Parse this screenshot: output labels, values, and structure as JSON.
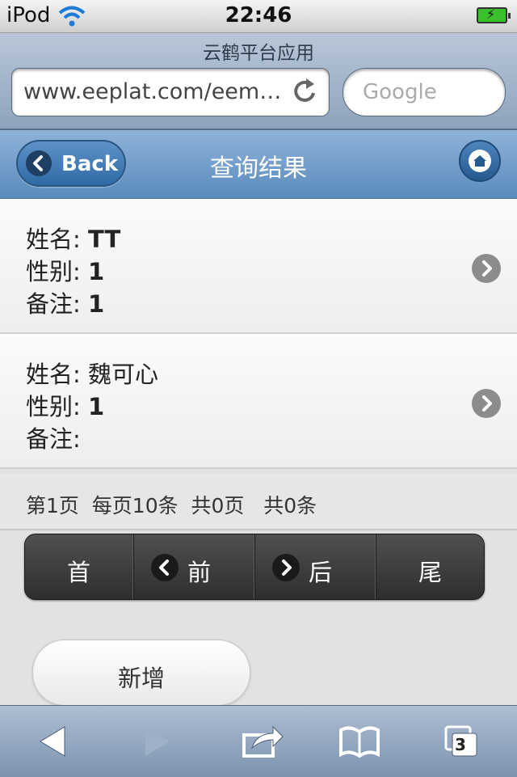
{
  "status_bar": {
    "carrier": "iPod",
    "time": "22:46"
  },
  "browser": {
    "page_title": "云鹤平台应用",
    "url": "www.eeplat.com/eem…",
    "search_placeholder": "Google"
  },
  "header": {
    "back_label": "Back",
    "title": "查询结果"
  },
  "results": [
    {
      "name_label": "姓名:",
      "name": "TT",
      "gender_label": "性别:",
      "gender": "1",
      "note_label": "备注:",
      "note": "1"
    },
    {
      "name_label": "姓名:",
      "name": "魏可心",
      "gender_label": "性别:",
      "gender": "1",
      "note_label": "备注:",
      "note": ""
    }
  ],
  "pager": {
    "info": "第1页  每页10条  共0页   共0条",
    "first": "首",
    "prev": "前",
    "next": "后",
    "last": "尾"
  },
  "actions": {
    "add_label": "新增"
  },
  "toolbar": {
    "tabs_count": "3"
  },
  "colors": {
    "header": "#5a8bbd",
    "battery": "#3ac02b"
  }
}
